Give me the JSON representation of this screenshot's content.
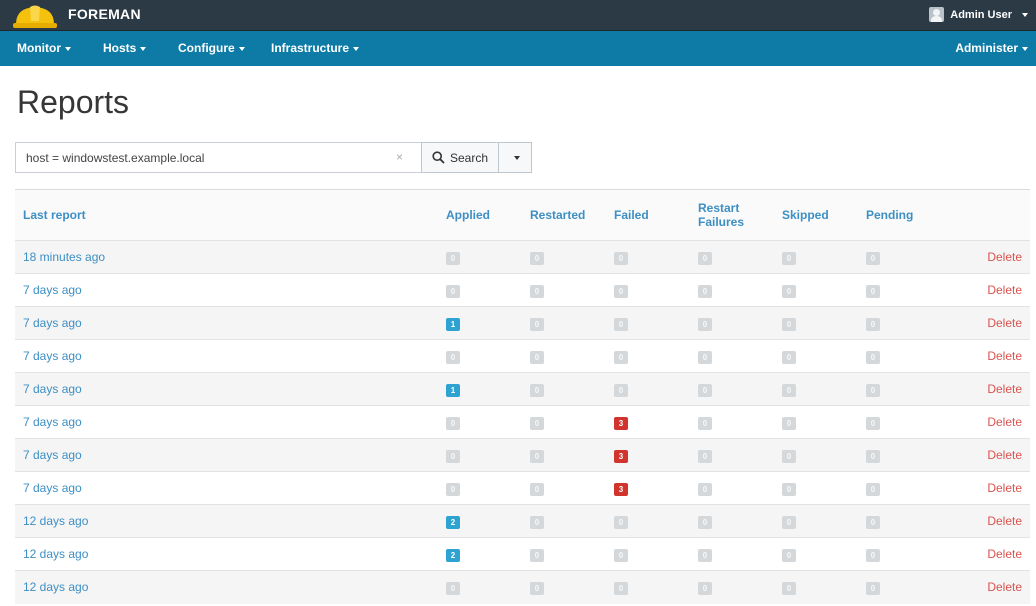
{
  "header": {
    "brand": "FOREMAN",
    "user": "Admin User"
  },
  "nav": {
    "monitor": "Monitor",
    "hosts": "Hosts",
    "configure": "Configure",
    "infrastructure": "Infrastructure",
    "administer": "Administer"
  },
  "page": {
    "title": "Reports"
  },
  "search": {
    "value": "host = windowstest.example.local",
    "button": "Search"
  },
  "table": {
    "headers": {
      "last_report": "Last report",
      "applied": "Applied",
      "restarted": "Restarted",
      "failed": "Failed",
      "restart_failures": "Restart Failures",
      "skipped": "Skipped",
      "pending": "Pending"
    },
    "delete_label": "Delete",
    "rows": [
      {
        "last": "18 minutes ago",
        "counts": [
          0,
          0,
          0,
          0,
          0,
          0
        ]
      },
      {
        "last": "7 days ago",
        "counts": [
          0,
          0,
          0,
          0,
          0,
          0
        ]
      },
      {
        "last": "7 days ago",
        "counts": [
          1,
          0,
          0,
          0,
          0,
          0
        ]
      },
      {
        "last": "7 days ago",
        "counts": [
          0,
          0,
          0,
          0,
          0,
          0
        ]
      },
      {
        "last": "7 days ago",
        "counts": [
          1,
          0,
          0,
          0,
          0,
          0
        ]
      },
      {
        "last": "7 days ago",
        "counts": [
          0,
          0,
          3,
          0,
          0,
          0
        ]
      },
      {
        "last": "7 days ago",
        "counts": [
          0,
          0,
          3,
          0,
          0,
          0
        ]
      },
      {
        "last": "7 days ago",
        "counts": [
          0,
          0,
          3,
          0,
          0,
          0
        ]
      },
      {
        "last": "12 days ago",
        "counts": [
          2,
          0,
          0,
          0,
          0,
          0
        ]
      },
      {
        "last": "12 days ago",
        "counts": [
          2,
          0,
          0,
          0,
          0,
          0
        ]
      },
      {
        "last": "12 days ago",
        "counts": [
          0,
          0,
          0,
          0,
          0,
          0
        ]
      }
    ]
  },
  "colors": {
    "topbar": "#2c3a45",
    "navbar": "#0d7ba6",
    "link": "#3d8fc4",
    "delete": "#d9534f",
    "applied_badge": "#2ea2d0",
    "failed_badge": "#d0342c",
    "zero_badge": "#d5d8da"
  }
}
